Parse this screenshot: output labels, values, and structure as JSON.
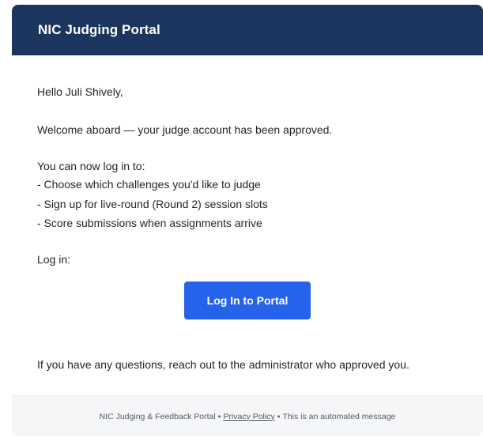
{
  "header": {
    "title": "NIC Judging Portal"
  },
  "body": {
    "greeting": "Hello Juli Shively,",
    "welcome": "Welcome aboard — your judge account has been approved.",
    "intro": "You can now log in to:",
    "items": [
      "- Choose which challenges you'd like to judge",
      "- Sign up for live-round (Round 2) session slots",
      "- Score submissions when assignments arrive"
    ],
    "login_label": "Log in:",
    "button_label": "Log In to Portal",
    "closing": "If you have any questions, reach out to the administrator who approved you."
  },
  "footer": {
    "portal_name": "NIC Judging & Feedback Portal",
    "separator": "•",
    "privacy_link": "Privacy Policy",
    "automated_note": "This is an automated message"
  },
  "colors": {
    "header_bg": "#1c355e",
    "button_bg": "#2563eb",
    "footer_bg": "#f5f6f7"
  }
}
